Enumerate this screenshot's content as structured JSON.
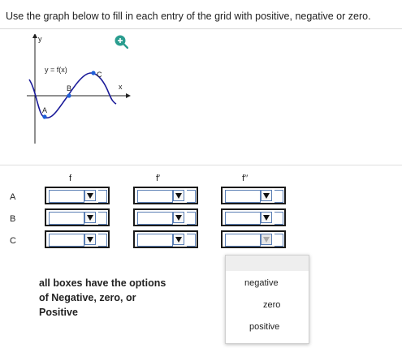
{
  "instruction": "Use the graph below to fill in each entry of the grid with positive, negative or zero.",
  "graph": {
    "y_axis_label": "y",
    "x_axis_label": "x",
    "function_label": "y = f(x)",
    "point_labels": {
      "A": "A",
      "B": "B",
      "C": "C"
    }
  },
  "icons": {
    "zoom": "zoom-in-icon"
  },
  "grid": {
    "columns": [
      "f",
      "f′",
      "f′′"
    ],
    "rows": [
      "A",
      "B",
      "C"
    ],
    "selected_values": [
      "",
      "",
      "",
      "",
      "",
      "",
      "",
      "",
      ""
    ]
  },
  "note": "all boxes have the options of Negative, zero, or Positive",
  "dropdown": {
    "options": [
      "negative",
      "zero",
      "positive"
    ]
  },
  "colors": {
    "curve": "#1a1a99",
    "point": "#1f5fd8",
    "zoom": "#2a9d8f"
  }
}
